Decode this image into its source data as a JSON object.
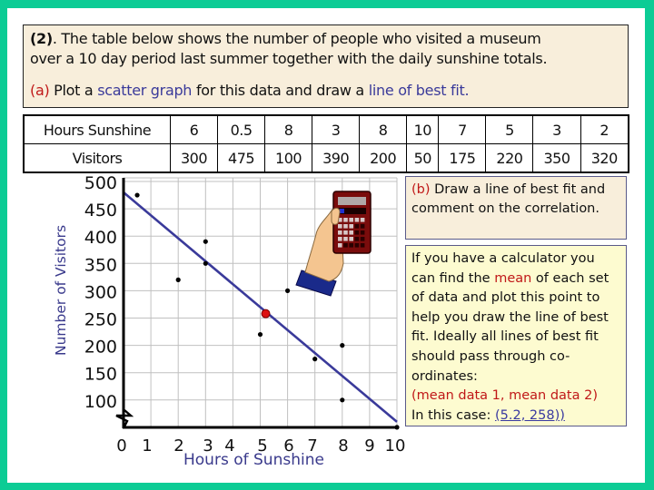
{
  "question": {
    "number": "(2)",
    "line1": ". The table below shows the number of people who visited a museum",
    "line2": "over a 10 day period last summer together with the daily sunshine totals.",
    "part_a_label": "(a)",
    "part_a_text1": " Plot a ",
    "part_a_link1": "scatter graph",
    "part_a_text2": " for this data and draw a ",
    "part_a_link2": "line of best fit."
  },
  "table": {
    "row1_header": "Hours Sunshine",
    "row1": [
      "6",
      "0.5",
      "8",
      "3",
      "8",
      "10",
      "7",
      "5",
      "3",
      "2"
    ],
    "row2_header": "Visitors",
    "row2": [
      "300",
      "475",
      "100",
      "390",
      "200",
      "50",
      "175",
      "220",
      "350",
      "320"
    ]
  },
  "part_b": {
    "label": "(b)",
    "text": " Draw a line of best fit and comment on the correlation."
  },
  "info": {
    "text1": "If you have a calculator you can find the ",
    "highlight": "mean",
    "text2": " of each set of data and plot this point to help you draw the line of best fit. Ideally all lines of best fit should pass through co-ordinates:",
    "formula": "(mean data 1, mean data 2)",
    "case_label": "In this case: ",
    "case_value": "(5.2, 258))"
  },
  "colors": {
    "frame": "#0ccc95",
    "line": "#3a3a9a",
    "mean_point": "#dd1111",
    "points": "#000000",
    "grid": "#c0c0c0",
    "label_text": "#3a3a8c"
  },
  "chart_data": {
    "type": "scatter",
    "title": "",
    "xlabel": "Hours of Sunshine",
    "ylabel": "Number of Visitors",
    "xlim": [
      0,
      10
    ],
    "ylim": [
      50,
      500
    ],
    "x_ticks": [
      "0",
      "1",
      "2",
      "3",
      "4",
      "5",
      "6",
      "7",
      "8",
      "9",
      "10"
    ],
    "y_ticks": [
      "500",
      "450",
      "400",
      "350",
      "300",
      "250",
      "200",
      "150",
      "100"
    ],
    "y_tick_values": [
      500,
      450,
      400,
      350,
      300,
      250,
      200,
      150,
      100
    ],
    "grid": true,
    "axis_break": "y",
    "points": [
      {
        "x": 6,
        "y": 300
      },
      {
        "x": 0.5,
        "y": 475
      },
      {
        "x": 8,
        "y": 100
      },
      {
        "x": 3,
        "y": 390
      },
      {
        "x": 8,
        "y": 200
      },
      {
        "x": 10,
        "y": 50
      },
      {
        "x": 7,
        "y": 175
      },
      {
        "x": 5,
        "y": 220
      },
      {
        "x": 3,
        "y": 350
      },
      {
        "x": 2,
        "y": 320
      }
    ],
    "mean_point": {
      "x": 5.2,
      "y": 258
    },
    "best_fit_line": {
      "x1": 0,
      "y1": 480,
      "x2": 10,
      "y2": 55
    }
  }
}
